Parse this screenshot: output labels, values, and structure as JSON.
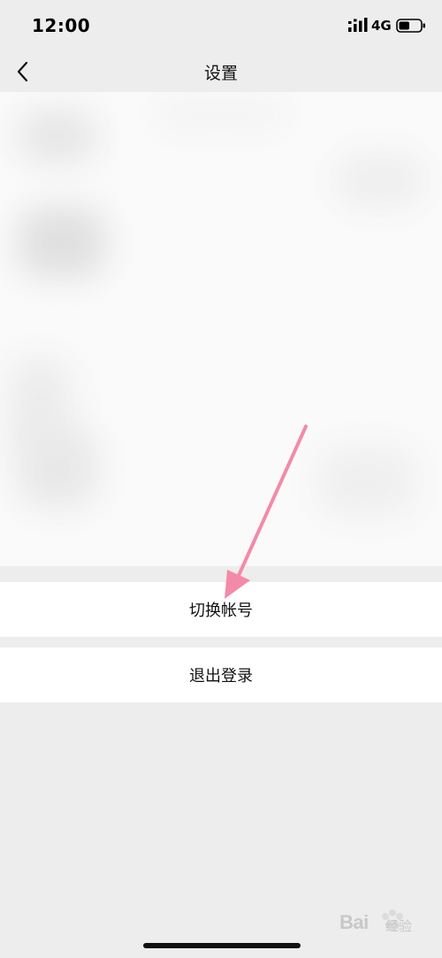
{
  "status_bar": {
    "time": "12:00",
    "network": "4G",
    "signal_icon": "signal-bars-icon",
    "battery_icon": "battery-icon",
    "battery_level": 0.5
  },
  "nav": {
    "title": "设置",
    "back_icon": "chevron-left-icon"
  },
  "actions": {
    "switch_account": "切换帐号",
    "logout": "退出登录"
  },
  "annotation": {
    "arrow_color": "#f48aa8",
    "arrow_icon": "arrow-annotation-icon"
  },
  "watermark": {
    "brand": "Bai",
    "suffix": "经验",
    "logo_icon": "paw-logo-icon"
  },
  "colors": {
    "background": "#ededed",
    "row_background": "#ffffff",
    "text": "#111111"
  }
}
